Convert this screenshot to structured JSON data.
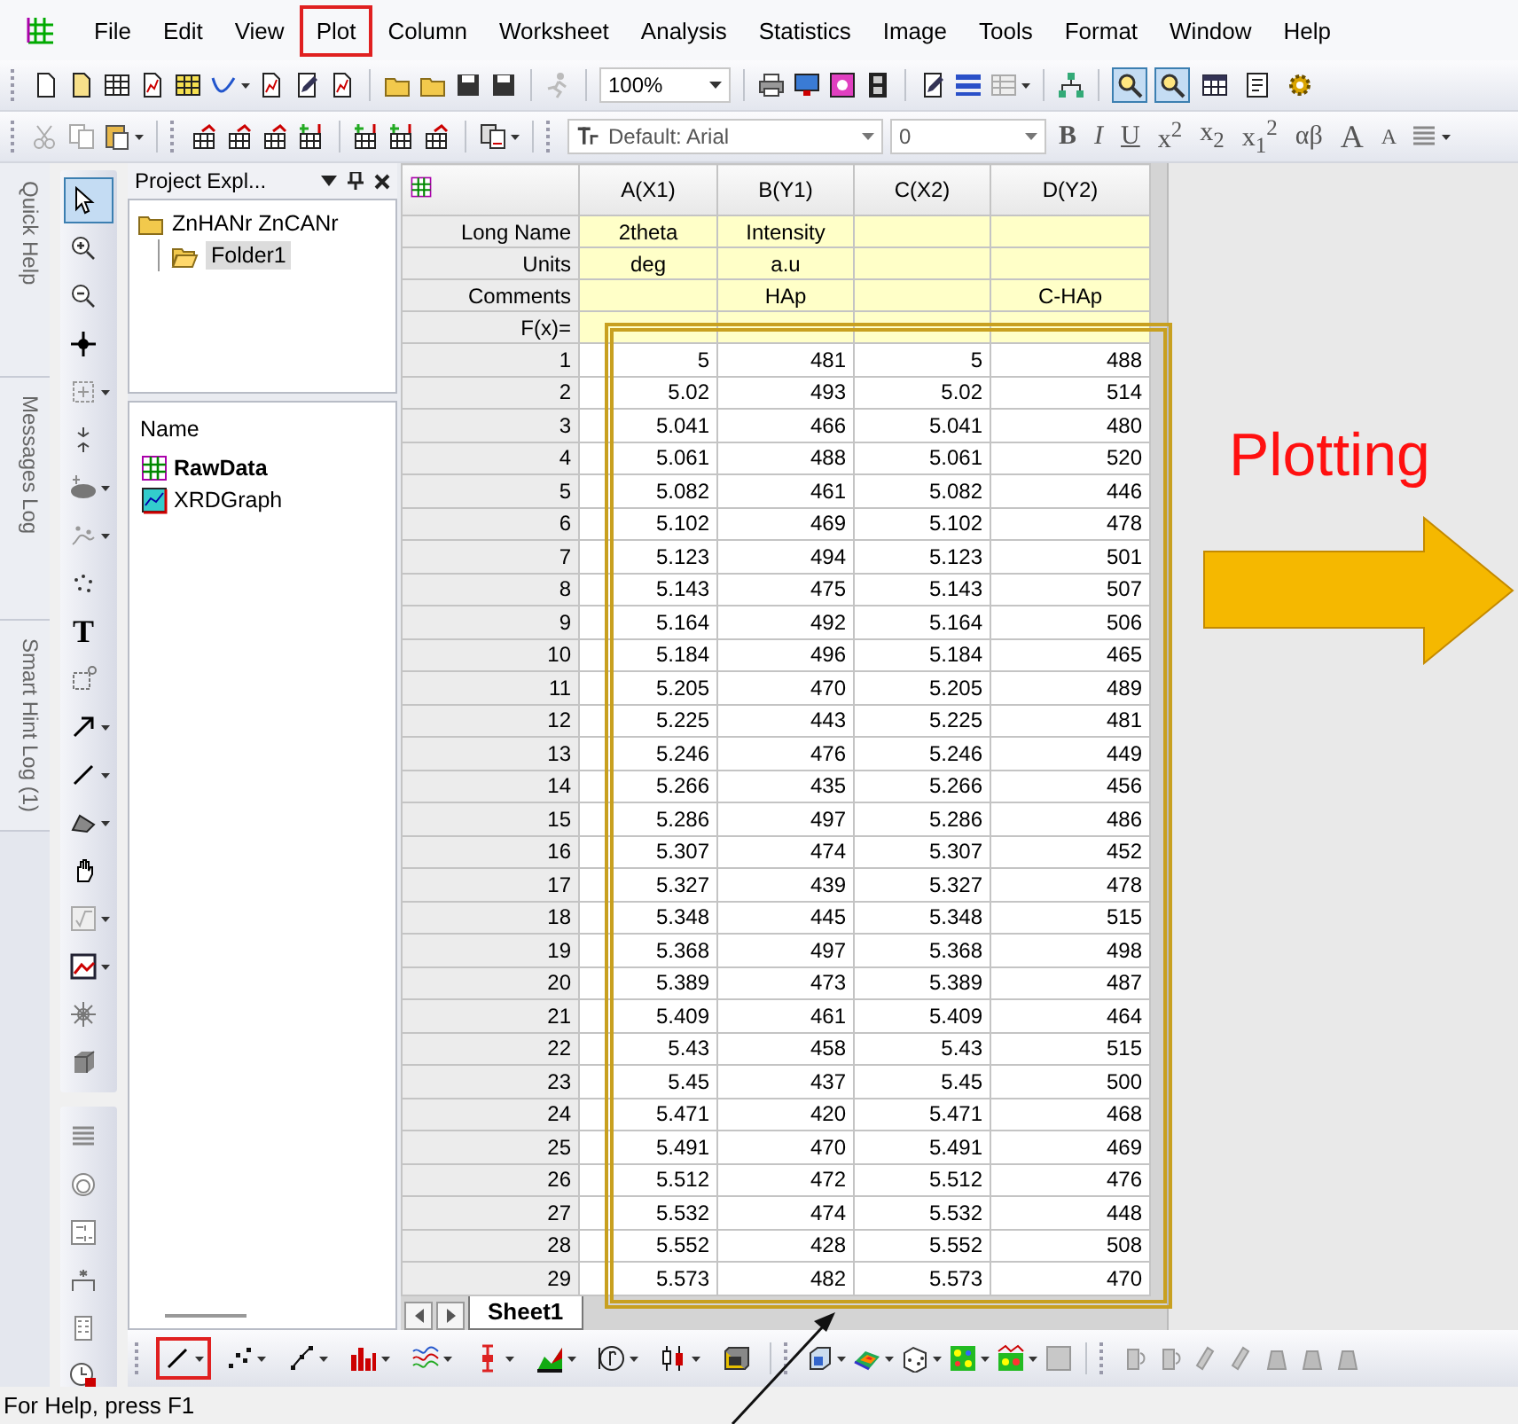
{
  "menu_bar": {
    "items": [
      {
        "label": "File",
        "highlighted": false
      },
      {
        "label": "Edit",
        "highlighted": false
      },
      {
        "label": "View",
        "highlighted": false
      },
      {
        "label": "Plot",
        "highlighted": true
      },
      {
        "label": "Column",
        "highlighted": false
      },
      {
        "label": "Worksheet",
        "highlighted": false
      },
      {
        "label": "Analysis",
        "highlighted": false
      },
      {
        "label": "Statistics",
        "highlighted": false
      },
      {
        "label": "Image",
        "highlighted": false
      },
      {
        "label": "Tools",
        "highlighted": false
      },
      {
        "label": "Format",
        "highlighted": false
      },
      {
        "label": "Window",
        "highlighted": false
      },
      {
        "label": "Help",
        "highlighted": false
      }
    ]
  },
  "standard_toolbar": {
    "zoom": "100%",
    "view_buttons": [
      {
        "pressed": true
      },
      {
        "pressed": true
      },
      {
        "pressed": false
      },
      {
        "pressed": false
      },
      {
        "pressed": false
      }
    ]
  },
  "format_toolbar": {
    "font": "Default: Arial",
    "font_size": "0",
    "buttons": [
      "B",
      "I",
      "U",
      "x$^{2}$",
      "x$_{2}$",
      "x$_{1}$$^{2}$",
      "αβ",
      "A",
      "A"
    ]
  },
  "side_tabs": [
    "Quick Help",
    "Messages Log",
    "Smart Hint Log (1)"
  ],
  "tool_palette": [
    {
      "selected": true
    },
    {
      "selected": false
    },
    {
      "selected": false
    },
    {
      "selected": false
    },
    {
      "selected": false
    },
    {
      "selected": false
    },
    {
      "selected": false
    },
    {
      "selected": false
    },
    {
      "selected": false
    },
    {
      "label": "T",
      "selected": false
    },
    {
      "selected": false
    },
    {
      "selected": false
    },
    {
      "selected": false
    },
    {
      "selected": false
    },
    {
      "selected": false
    },
    {
      "selected": false
    },
    {
      "selected": false
    },
    {
      "selected": false
    },
    {
      "selected": false
    }
  ],
  "project_explorer": {
    "title": "Project Expl...",
    "tree": [
      {
        "label": "ZnHANr ZnCANr",
        "selected": false,
        "children": [
          {
            "label": "Folder1",
            "selected": true
          }
        ]
      }
    ],
    "list_header": "Name",
    "items": [
      {
        "name": "RawData",
        "kind": "worksheet",
        "active": true
      },
      {
        "name": "XRDGraph",
        "kind": "graph",
        "active": false
      }
    ]
  },
  "worksheet": {
    "columns": [
      "A(X1)",
      "B(Y1)",
      "C(X2)",
      "D(Y2)"
    ],
    "label_rows": [
      {
        "label": "Long Name",
        "cells": [
          "2theta",
          "Intensity",
          null,
          null
        ]
      },
      {
        "label": "Units",
        "cells": [
          "deg",
          "a.u",
          null,
          null
        ]
      },
      {
        "label": "Comments",
        "cells": [
          null,
          "HAp",
          null,
          "C-HAp"
        ]
      },
      {
        "label": "F(x)=",
        "cells": [
          null,
          null,
          null,
          null
        ]
      }
    ],
    "rows": [
      {
        "label": "1",
        "cells": [
          "5",
          "481",
          "5",
          "488"
        ]
      },
      {
        "label": "2",
        "cells": [
          "5.02",
          "493",
          "5.02",
          "514"
        ]
      },
      {
        "label": "3",
        "cells": [
          "5.041",
          "466",
          "5.041",
          "480"
        ]
      },
      {
        "label": "4",
        "cells": [
          "5.061",
          "488",
          "5.061",
          "520"
        ]
      },
      {
        "label": "5",
        "cells": [
          "5.082",
          "461",
          "5.082",
          "446"
        ]
      },
      {
        "label": "6",
        "cells": [
          "5.102",
          "469",
          "5.102",
          "478"
        ]
      },
      {
        "label": "7",
        "cells": [
          "5.123",
          "494",
          "5.123",
          "501"
        ]
      },
      {
        "label": "8",
        "cells": [
          "5.143",
          "475",
          "5.143",
          "507"
        ]
      },
      {
        "label": "9",
        "cells": [
          "5.164",
          "492",
          "5.164",
          "506"
        ]
      },
      {
        "label": "10",
        "cells": [
          "5.184",
          "496",
          "5.184",
          "465"
        ]
      },
      {
        "label": "11",
        "cells": [
          "5.205",
          "470",
          "5.205",
          "489"
        ]
      },
      {
        "label": "12",
        "cells": [
          "5.225",
          "443",
          "5.225",
          "481"
        ]
      },
      {
        "label": "13",
        "cells": [
          "5.246",
          "476",
          "5.246",
          "449"
        ]
      },
      {
        "label": "14",
        "cells": [
          "5.266",
          "435",
          "5.266",
          "456"
        ]
      },
      {
        "label": "15",
        "cells": [
          "5.286",
          "497",
          "5.286",
          "486"
        ]
      },
      {
        "label": "16",
        "cells": [
          "5.307",
          "474",
          "5.307",
          "452"
        ]
      },
      {
        "label": "17",
        "cells": [
          "5.327",
          "439",
          "5.327",
          "478"
        ]
      },
      {
        "label": "18",
        "cells": [
          "5.348",
          "445",
          "5.348",
          "515"
        ]
      },
      {
        "label": "19",
        "cells": [
          "5.368",
          "497",
          "5.368",
          "498"
        ]
      },
      {
        "label": "20",
        "cells": [
          "5.389",
          "473",
          "5.389",
          "487"
        ]
      },
      {
        "label": "21",
        "cells": [
          "5.409",
          "461",
          "5.409",
          "464"
        ]
      },
      {
        "label": "22",
        "cells": [
          "5.43",
          "458",
          "5.43",
          "515"
        ]
      },
      {
        "label": "23",
        "cells": [
          "5.45",
          "437",
          "5.45",
          "500"
        ]
      },
      {
        "label": "24",
        "cells": [
          "5.471",
          "420",
          "5.471",
          "468"
        ]
      },
      {
        "label": "25",
        "cells": [
          "5.491",
          "470",
          "5.491",
          "469"
        ]
      },
      {
        "label": "26",
        "cells": [
          "5.512",
          "472",
          "5.512",
          "476"
        ]
      },
      {
        "label": "27",
        "cells": [
          "5.532",
          "474",
          "5.532",
          "448"
        ]
      },
      {
        "label": "28",
        "cells": [
          "5.552",
          "428",
          "5.552",
          "508"
        ]
      },
      {
        "label": "29",
        "cells": [
          "5.573",
          "482",
          "5.573",
          "470"
        ]
      }
    ],
    "sheet_tabs": [
      {
        "label": "Sheet1",
        "selected": true
      }
    ]
  },
  "plot_toolbar": [
    {
      "highlighted": true
    },
    {
      "highlighted": false
    },
    {
      "highlighted": false
    },
    {
      "highlighted": false
    },
    {
      "highlighted": false
    },
    {
      "highlighted": false
    },
    {
      "highlighted": false
    },
    {
      "highlighted": false
    },
    {
      "highlighted": false
    },
    {
      "highlighted": false
    }
  ],
  "annotation": {
    "label": "Plotting"
  },
  "status_bar": "For Help, press F1"
}
